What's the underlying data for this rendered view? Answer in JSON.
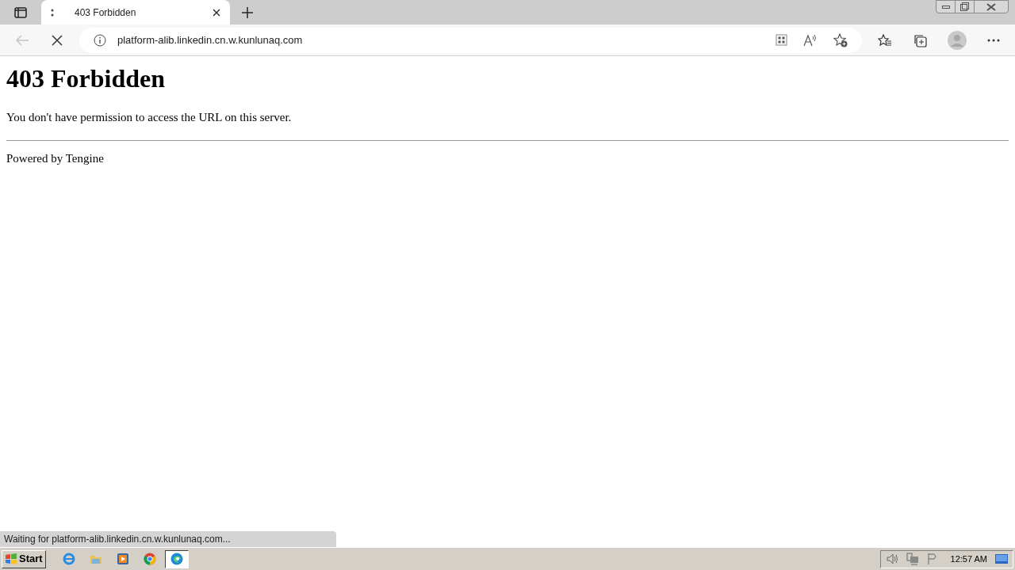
{
  "browser": {
    "tab": {
      "title": "403 Forbidden",
      "loading": true
    },
    "address": "platform-alib.linkedin.cn.w.kunlunaq.com",
    "back_disabled": true
  },
  "page": {
    "heading": "403 Forbidden",
    "message": "You don't have permission to access the URL on this server.",
    "footer": "Powered by Tengine"
  },
  "status_bar": "Waiting for platform-alib.linkedin.cn.w.kunlunaq.com...",
  "taskbar": {
    "start": "Start",
    "apps": [
      {
        "kind": "ie",
        "selected": false
      },
      {
        "kind": "folder",
        "selected": false
      },
      {
        "kind": "media",
        "selected": false
      },
      {
        "kind": "chrome",
        "selected": false
      },
      {
        "kind": "edge",
        "selected": true
      }
    ],
    "clock": "12:57 AM"
  }
}
